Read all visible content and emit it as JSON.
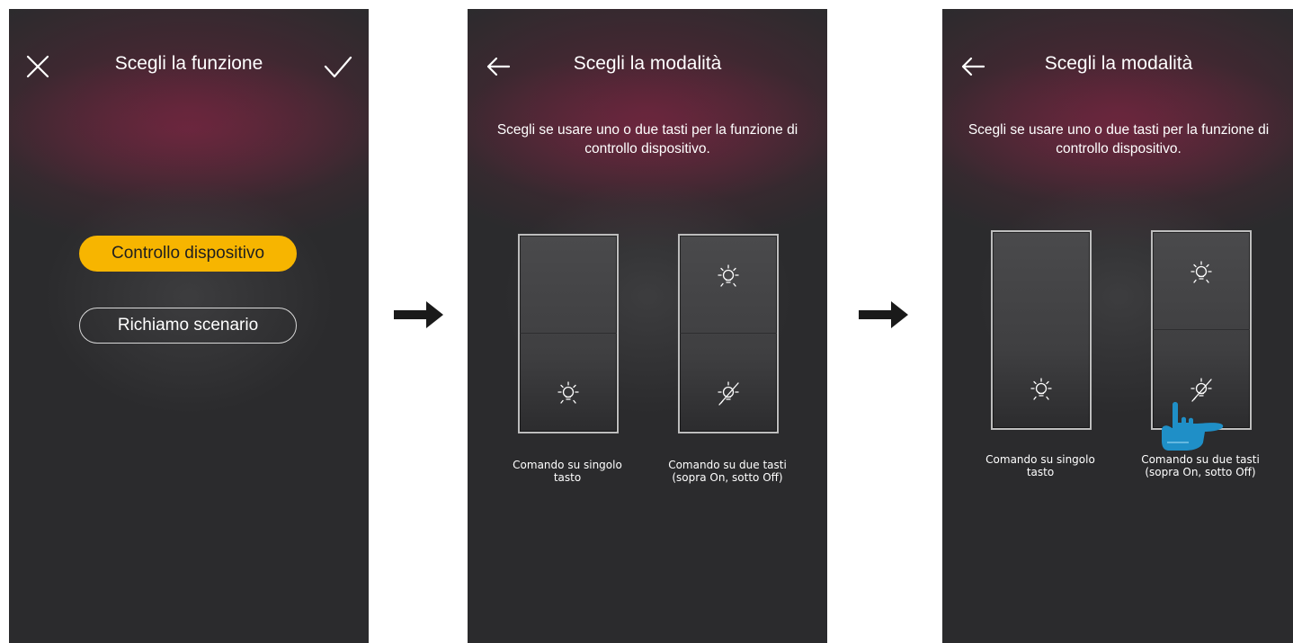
{
  "screens": [
    {
      "title": "Scegli la funzione",
      "left_icon": "close-icon",
      "right_icon": "check-icon",
      "options": [
        "Controllo dispositivo",
        "Richiamo scenario"
      ],
      "selected_option": "Controllo dispositivo"
    },
    {
      "title": "Scegli la modalità",
      "left_icon": "back-arrow-icon",
      "subtitle": "Scegli se usare uno o due tasti per la funzione di controllo dispositivo.",
      "choices": [
        {
          "label": "Comando su singolo tasto",
          "icons": [
            "bulb-on-icon"
          ]
        },
        {
          "label": "Comando su due tasti (sopra On, sotto Off)",
          "icons": [
            "bulb-on-icon",
            "bulb-off-icon"
          ]
        }
      ]
    },
    {
      "title": "Scegli la modalità",
      "left_icon": "back-arrow-icon",
      "subtitle": "Scegli se usare uno o due tasti per la funzione di controllo dispositivo.",
      "choices": [
        {
          "label": "Comando su singolo tasto",
          "icons": [
            "bulb-on-icon"
          ]
        },
        {
          "label": "Comando su due tasti (sopra On, sotto Off)",
          "icons": [
            "bulb-on-icon",
            "bulb-off-icon"
          ]
        }
      ],
      "tapped_choice": "Comando su due tasti (sopra On, sotto Off)",
      "pointer_icon": "tap-hand-icon"
    }
  ],
  "flow_arrows": [
    "right-arrow-icon",
    "right-arrow-icon"
  ],
  "colors": {
    "screen_background": "#2b2b2d",
    "accent": "#f7b500",
    "header_glow": "#7a2a45",
    "hand": "#1f8fc7",
    "text": "#ffffff"
  }
}
